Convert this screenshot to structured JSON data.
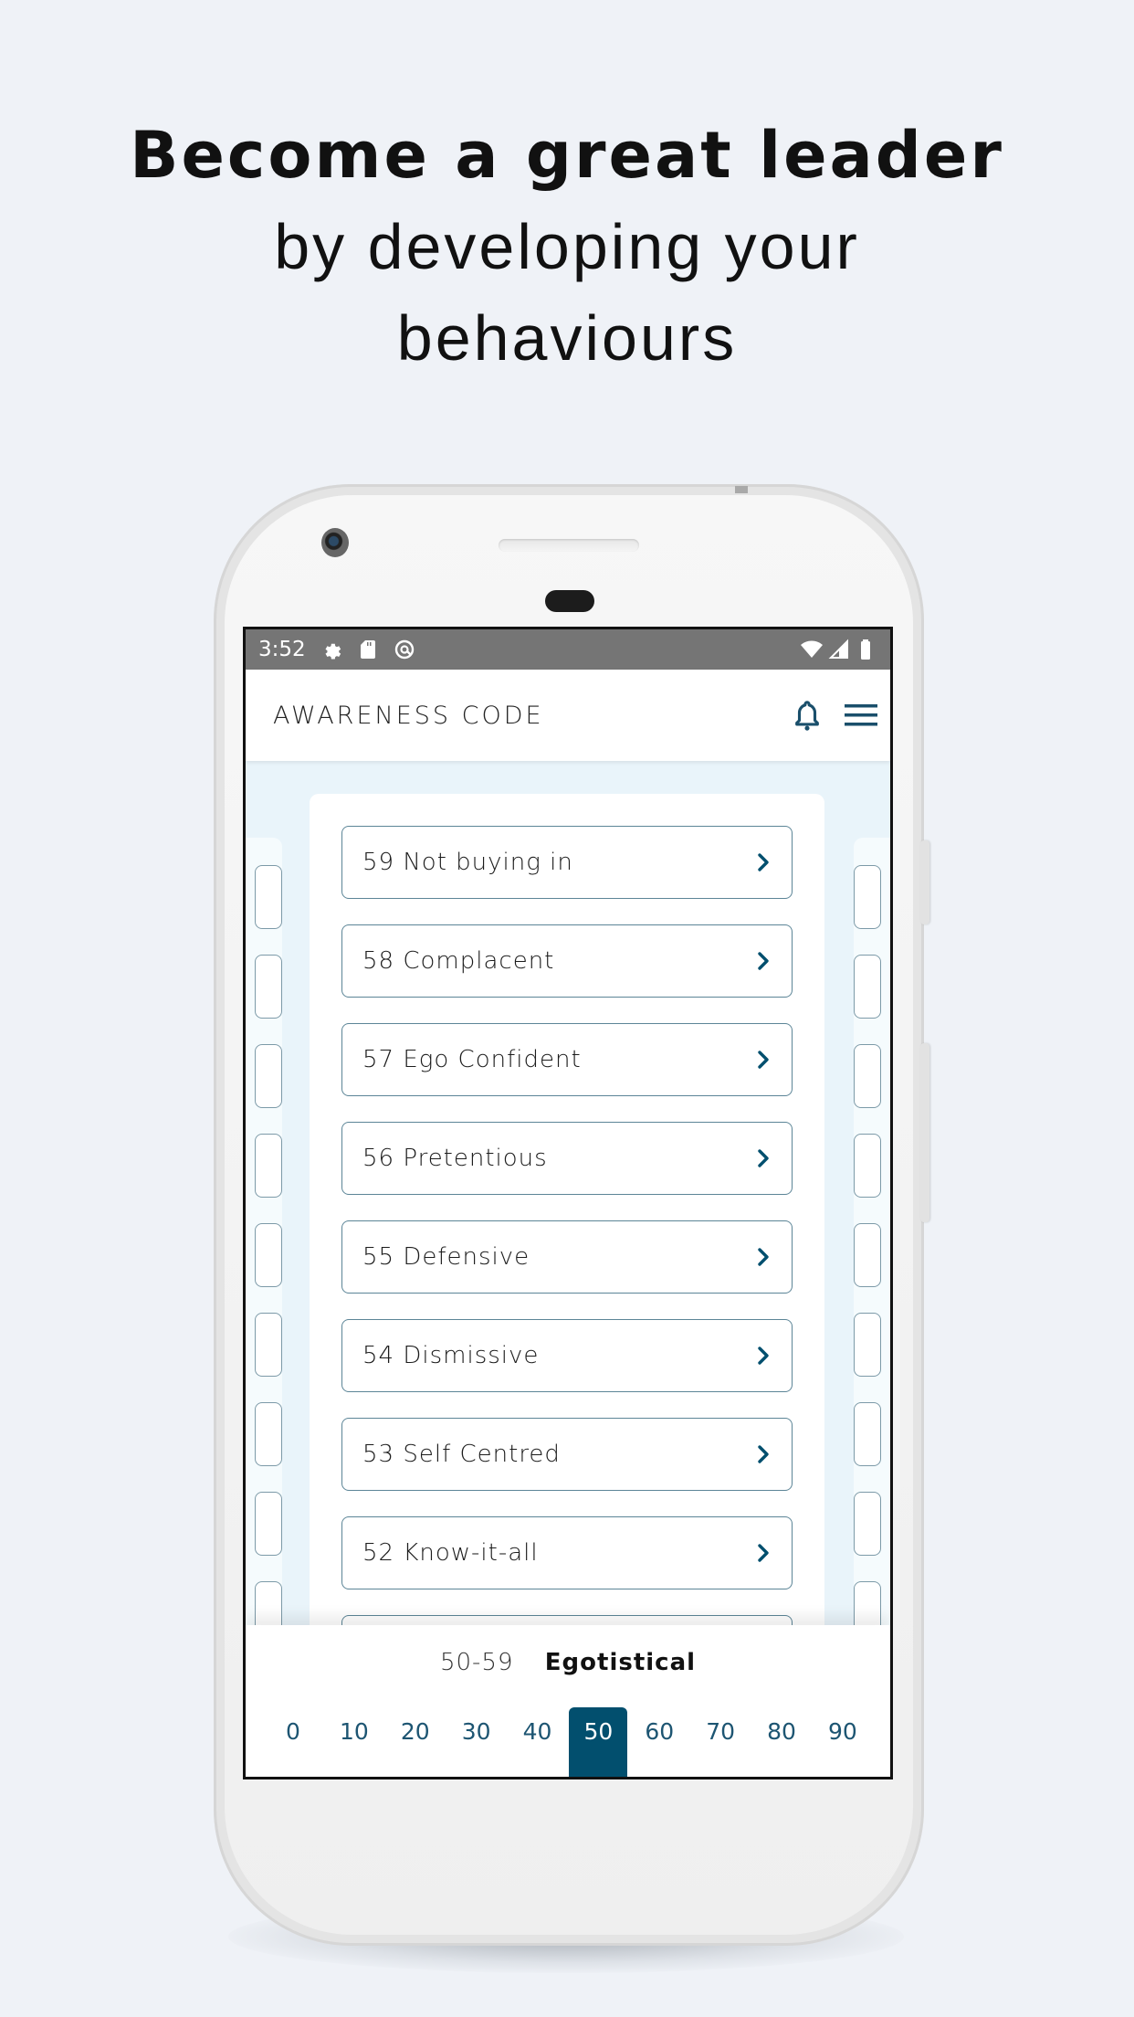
{
  "headline": {
    "line1": "Become a great leader",
    "line2": "by developing your",
    "line3": "behaviours"
  },
  "statusbar": {
    "time": "3:52",
    "left_icons": [
      "gear-icon",
      "sd-card-icon",
      "at-sign-icon"
    ],
    "right_icons": [
      "wifi-icon",
      "cell-signal-icon",
      "battery-icon"
    ]
  },
  "appbar": {
    "title": "AWARENESS CODE",
    "icons": [
      "bell-icon",
      "menu-icon"
    ]
  },
  "behaviours": [
    {
      "label": "59 Not buying in"
    },
    {
      "label": "58 Complacent"
    },
    {
      "label": "57 Ego Confident"
    },
    {
      "label": "56 Pretentious"
    },
    {
      "label": "55 Defensive"
    },
    {
      "label": "54 Dismissive"
    },
    {
      "label": "53 Self Centred"
    },
    {
      "label": "52 Know-it-all"
    }
  ],
  "bottom": {
    "range": "50-59",
    "category": "Egotistical",
    "tabs": [
      "0",
      "10",
      "20",
      "30",
      "40",
      "50",
      "60",
      "70",
      "80",
      "90"
    ],
    "active_tab": "50"
  },
  "colors": {
    "accent": "#024f6e",
    "item_border": "#5c8597",
    "content_bg": "#e9f4fa",
    "page_bg": "#eff2f7",
    "statusbar_bg": "#757575"
  }
}
